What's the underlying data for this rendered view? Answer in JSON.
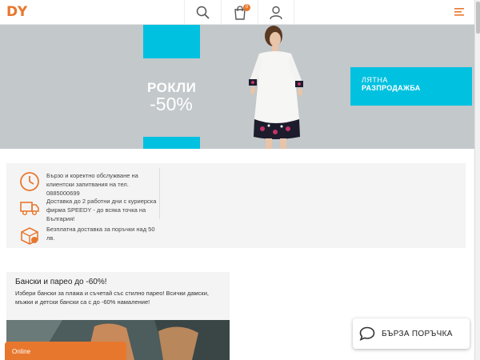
{
  "header": {
    "logo_text": "DY",
    "search_icon": "search-icon",
    "cart_icon": "shopping-bag-icon",
    "cart_count": "0",
    "user_icon": "user-icon",
    "menu_icon": "hamburger-menu-icon",
    "accent_color": "#e8772e"
  },
  "banner": {
    "promo_title": "РОКЛИ",
    "promo_discount": "-50%",
    "sale_line1": "ЛЯТНА",
    "sale_line2": "РАЗПРОДАЖБА",
    "accent_color": "#00c1e0"
  },
  "info": {
    "items": [
      {
        "icon": "clock-icon",
        "text": "Бързо и коректно обслужване на клиентски запитвания на тел. 0885000699"
      },
      {
        "icon": "delivery-truck-icon",
        "text": "Доставка до 2 работни дни с куриерска фирма SPEEDY - до всяка точка на България!"
      },
      {
        "icon": "free-shipping-box-icon",
        "text": "Безплатна доставка за поръчки над 50 лв."
      }
    ]
  },
  "category": {
    "title": "Бански и парео до -60%!",
    "description": "Избери бански за плажа и съчетай със стилно парео! Всички дамски, мъжки и детски бански са с до -60% намаление!"
  },
  "chat": {
    "online_label": "Online"
  },
  "quick_order": {
    "icon": "chat-bubble-icon",
    "label": "БЪРЗА ПОРЪЧКА"
  }
}
